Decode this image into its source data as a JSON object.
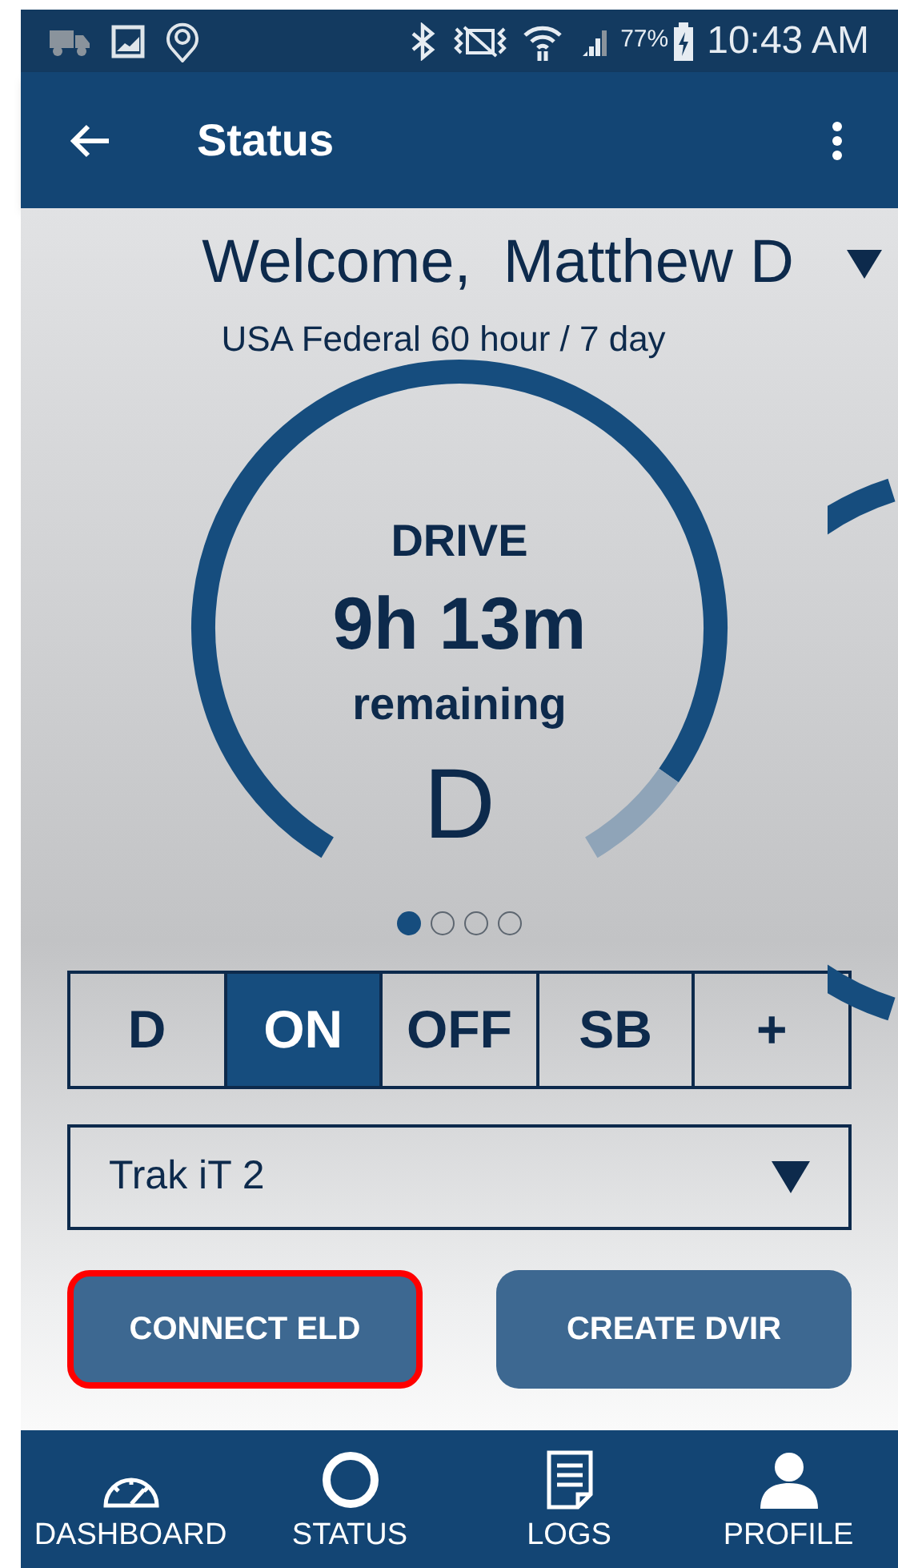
{
  "status_bar": {
    "battery": "77%",
    "time": "10:43 AM"
  },
  "app_bar": {
    "title": "Status"
  },
  "welcome": {
    "greeting": "Welcome,",
    "name": "Matthew D",
    "ruleset": "USA Federal 60 hour / 7 day"
  },
  "gauge": {
    "label": "DRIVE",
    "time": "9h 13m",
    "caption": "remaining",
    "status": "D"
  },
  "pages": [
    {
      "selected": true
    },
    {
      "selected": false
    },
    {
      "selected": false
    },
    {
      "selected": false
    }
  ],
  "duty_tabs": [
    {
      "label": "D",
      "selected": false
    },
    {
      "label": "ON",
      "selected": true
    },
    {
      "label": "OFF",
      "selected": false
    },
    {
      "label": "SB",
      "selected": false
    },
    {
      "label": "+",
      "selected": false
    }
  ],
  "vehicle_select": {
    "value": "Trak iT 2"
  },
  "buttons": [
    {
      "label": "CONNECT ELD",
      "highlighted": true
    },
    {
      "label": "CREATE DVIR",
      "highlighted": false
    }
  ],
  "bottom_nav": [
    {
      "label": "DASHBOARD",
      "kind": "dashboard"
    },
    {
      "label": "STATUS",
      "kind": "status"
    },
    {
      "label": "LOGS",
      "kind": "logs"
    },
    {
      "label": "PROFILE",
      "kind": "profile"
    }
  ]
}
